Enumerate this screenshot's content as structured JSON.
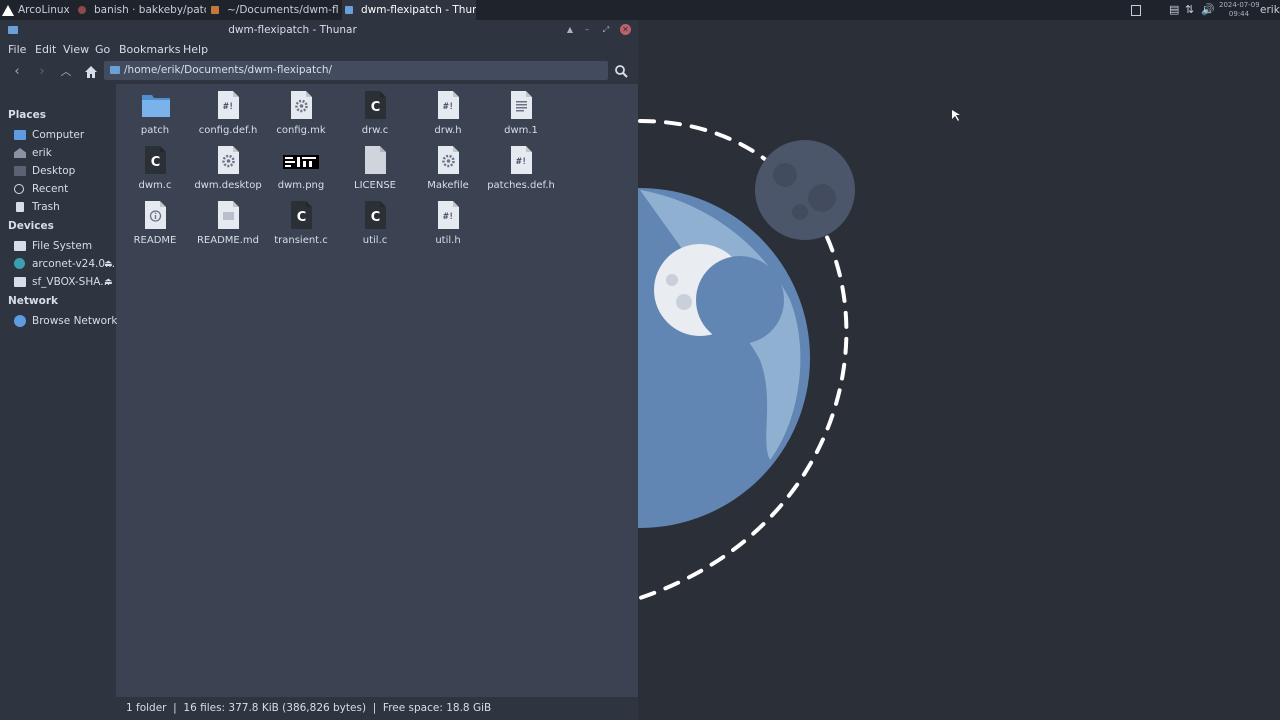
{
  "taskbar": {
    "distro": "ArcoLinux",
    "tabs": [
      {
        "label": "banish · bakkeby/patc..."
      },
      {
        "label": "~/Documents/dwm-fle..."
      },
      {
        "label": "dwm-flexipatch - Thun..."
      }
    ],
    "date": "2024-07-09",
    "time": "09:44",
    "user": "erik"
  },
  "window": {
    "title": "dwm-flexipatch - Thunar",
    "menu": [
      "File",
      "Edit",
      "View",
      "Go",
      "Bookmarks",
      "Help"
    ],
    "location": "/home/erik/Documents/dwm-flexipatch/"
  },
  "sidebar": {
    "places_heading": "Places",
    "places": [
      {
        "label": "Computer",
        "icon": "computer-icon"
      },
      {
        "label": "erik",
        "icon": "home-icon"
      },
      {
        "label": "Desktop",
        "icon": "desktop-icon"
      },
      {
        "label": "Recent",
        "icon": "recent-icon"
      },
      {
        "label": "Trash",
        "icon": "trash-icon"
      }
    ],
    "devices_heading": "Devices",
    "devices": [
      {
        "label": "File System",
        "icon": "drive-icon"
      },
      {
        "label": "arconet-v24.0...",
        "icon": "disc-icon"
      },
      {
        "label": "sf_VBOX-SHA...",
        "icon": "drive-icon"
      }
    ],
    "network_heading": "Network",
    "network": [
      {
        "label": "Browse Network",
        "icon": "network-icon"
      }
    ]
  },
  "files": [
    {
      "name": "patch",
      "type": "folder"
    },
    {
      "name": "config.def.h",
      "type": "script"
    },
    {
      "name": "config.mk",
      "type": "make"
    },
    {
      "name": "drw.c",
      "type": "c"
    },
    {
      "name": "drw.h",
      "type": "script"
    },
    {
      "name": "dwm.1",
      "type": "text"
    },
    {
      "name": "dwm.c",
      "type": "c"
    },
    {
      "name": "dwm.desktop",
      "type": "make"
    },
    {
      "name": "dwm.png",
      "type": "image"
    },
    {
      "name": "LICENSE",
      "type": "blank"
    },
    {
      "name": "Makefile",
      "type": "make"
    },
    {
      "name": "patches.def.h",
      "type": "script"
    },
    {
      "name": "README",
      "type": "info"
    },
    {
      "name": "README.md",
      "type": "doc"
    },
    {
      "name": "transient.c",
      "type": "c"
    },
    {
      "name": "util.c",
      "type": "c"
    },
    {
      "name": "util.h",
      "type": "script"
    }
  ],
  "status": "1 folder  |  16 files: 377.8 KiB (386,826 bytes)  |  Free space: 18.8 GiB",
  "colors": {
    "accent": "#5e81ac",
    "window_bg": "#3b4252",
    "panel_bg": "#2e3440",
    "close": "#bf616a"
  }
}
